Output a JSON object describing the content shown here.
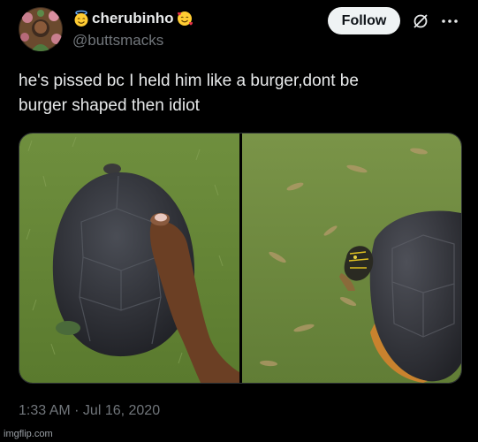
{
  "tweet": {
    "display_name": "cherubinho",
    "handle": "@buttsmacks",
    "follow_label": "Follow",
    "text_line1": "he's pissed bc I held him like a burger,dont be",
    "text_line2": "burger shaped then idiot",
    "timestamp": "1:33 AM · Jul 16, 2020",
    "emoji_left": "smiling-face-with-halo",
    "emoji_right": "smiling-face-with-hearts"
  },
  "icons": {
    "grok": "grok-icon",
    "more": "more-options-icon"
  },
  "media": {
    "image_left": "hand-holding-turtle-photo",
    "image_right": "turtle-on-grass-photo"
  },
  "watermark": "imgflip.com",
  "colors": {
    "background": "#000000",
    "text_primary": "#e7e9ea",
    "text_secondary": "#71767b",
    "follow_bg": "#eff3f4"
  }
}
